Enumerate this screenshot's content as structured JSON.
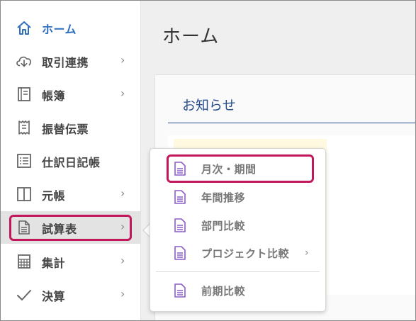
{
  "main": {
    "title": "ホーム",
    "notice_title": "お知らせ"
  },
  "sidebar": {
    "items": [
      {
        "label": "ホーム",
        "icon": "home-icon",
        "active": true,
        "has_submenu": false
      },
      {
        "label": "取引連携",
        "icon": "cloud-download-icon",
        "has_submenu": true
      },
      {
        "label": "帳簿",
        "icon": "book-icon",
        "has_submenu": true
      },
      {
        "label": "振替伝票",
        "icon": "receipt-icon",
        "has_submenu": false
      },
      {
        "label": "仕訳日記帳",
        "icon": "list-icon",
        "has_submenu": false
      },
      {
        "label": "元帳",
        "icon": "ledger-icon",
        "has_submenu": true
      },
      {
        "label": "試算表",
        "icon": "document-icon",
        "has_submenu": true,
        "selected": true
      },
      {
        "label": "集計",
        "icon": "calculator-icon",
        "has_submenu": true
      },
      {
        "label": "決算",
        "icon": "check-icon",
        "has_submenu": true
      }
    ],
    "chevron": "›"
  },
  "submenu": {
    "items": [
      {
        "label": "月次・期間",
        "highlighted": true
      },
      {
        "label": "年間推移"
      },
      {
        "label": "部門比較"
      },
      {
        "label": "プロジェクト比較",
        "has_submenu": true
      },
      {
        "label": "前期比較"
      }
    ],
    "chevron": "›"
  },
  "colors": {
    "accent": "#2e6fc0",
    "highlight": "#c2185b",
    "submenu_icon": "#8b5fc7"
  }
}
